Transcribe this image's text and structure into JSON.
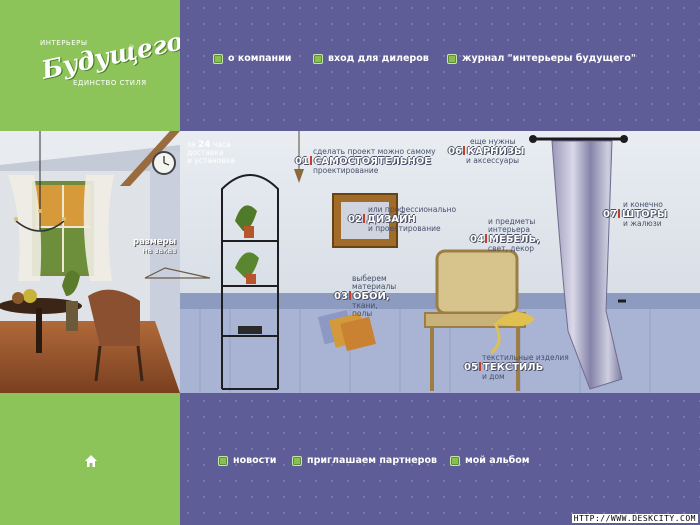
{
  "logo": {
    "top": "ИНТЕРЬЕРЫ",
    "main": "Будущего",
    "mark": "®",
    "tagline": "ЕДИНСТВО СТИЛЯ"
  },
  "top_nav": [
    {
      "label": "о компании"
    },
    {
      "label": "вход для дилеров"
    },
    {
      "label": "журнал \"интерьеры будущего\""
    }
  ],
  "bottom_nav": [
    {
      "label": "новости"
    },
    {
      "label": "приглашаем партнеров"
    },
    {
      "label": "мой альбом"
    }
  ],
  "promo": {
    "delivery": {
      "pre": "за",
      "num": "24",
      "unit": "часа",
      "line2": "доставка",
      "line3": "и установка"
    },
    "sizes": {
      "line1": "размеры",
      "line2": "на заказ"
    },
    "finally": {
      "line1": "и конечно"
    }
  },
  "sections": [
    {
      "num": "01",
      "title": "САМОСТОЯТЕЛЬНОЕ",
      "pre": "сделать проект можно самому",
      "post": "проектирование"
    },
    {
      "num": "02",
      "title": "ДИЗАЙН",
      "pre": "или профессионально",
      "post": "и проектирование"
    },
    {
      "num": "03",
      "title": "ОБОИ,",
      "pre1": "выберем",
      "pre2": "материалы",
      "post1": "ткани,",
      "post2": "полы"
    },
    {
      "num": "04",
      "title": "МЕБЕЛЬ,",
      "pre1": "и предметы",
      "pre2": "интерьера",
      "post": "свет, декор"
    },
    {
      "num": "05",
      "title": "ТЕКСТИЛЬ",
      "pre": "текстильные изделия",
      "post": "и дом"
    },
    {
      "num": "06",
      "title": "КАРНИЗЫ",
      "pre": "еще нужны",
      "post": "и аксессуары"
    },
    {
      "num": "07",
      "title": "ШТОРЫ",
      "post": "и жалюзи"
    }
  ],
  "watermark": "HTTP://WWW.DESKCITY.COM",
  "colors": {
    "green": "#8cc45a",
    "purple": "#5f5d98",
    "wall": "#dfe4ec"
  },
  "icons": {
    "home": "home-icon",
    "bullet": "square-bullet-icon"
  }
}
